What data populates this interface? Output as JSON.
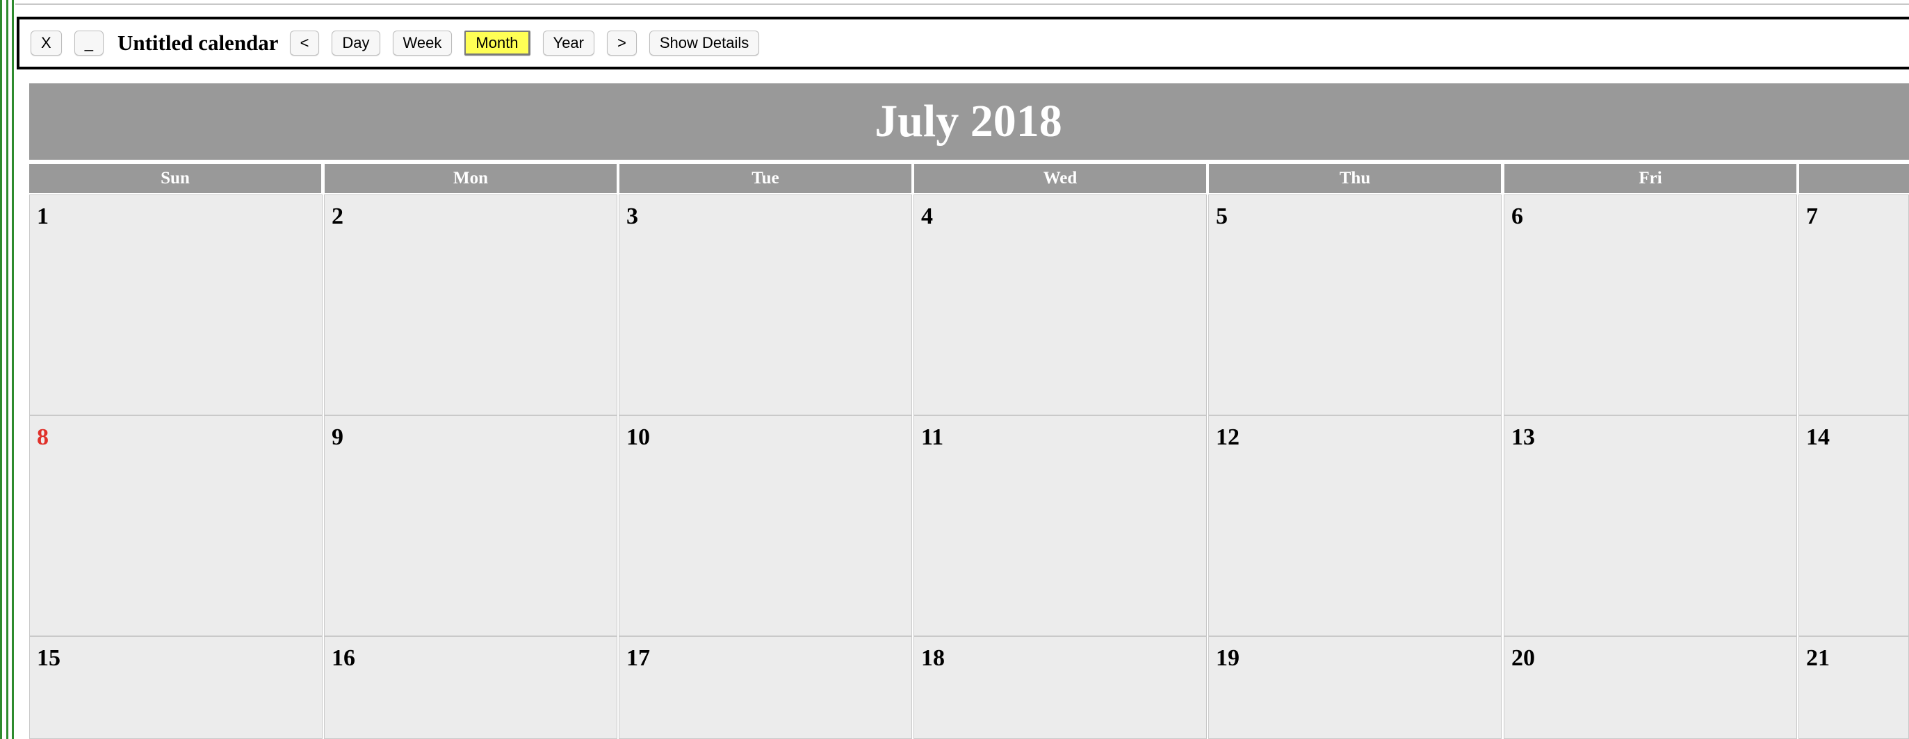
{
  "toolbar": {
    "close_label": "X",
    "minimize_label": "_",
    "title": "Untitled calendar",
    "prev_label": "<",
    "day_label": "Day",
    "week_label": "Week",
    "month_label": "Month",
    "year_label": "Year",
    "next_label": ">",
    "details_label": "Show Details",
    "active_view": "Month",
    "active_color": "#ffff55"
  },
  "calendar": {
    "month_title": "July 2018",
    "header_color": "#999999",
    "today_color": "#e0302a",
    "weekdays": [
      "Sun",
      "Mon",
      "Tue",
      "Wed",
      "Thu",
      "Fri"
    ],
    "weeks": [
      [
        "1",
        "2",
        "3",
        "4",
        "5",
        "6",
        "7"
      ],
      [
        "8",
        "9",
        "10",
        "11",
        "12",
        "13",
        "14"
      ],
      [
        "15",
        "16",
        "17",
        "18",
        "19",
        "20",
        "21"
      ]
    ],
    "today": "8"
  }
}
